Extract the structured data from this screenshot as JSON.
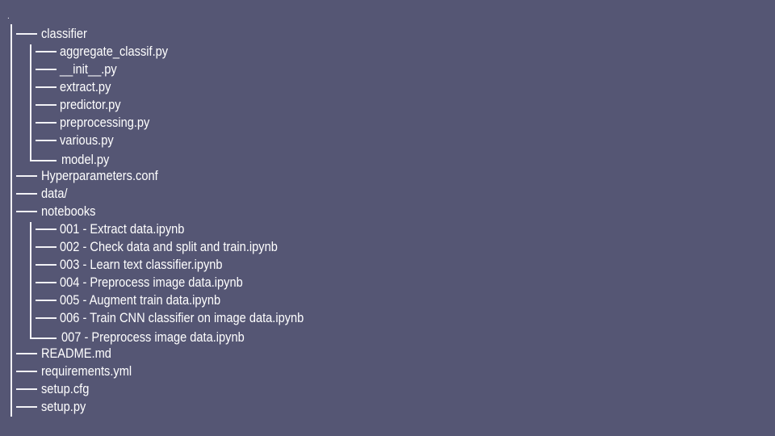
{
  "root": ".",
  "tree": [
    {
      "name": "classifier",
      "children": [
        "aggregate_classif.py",
        "__init__.py",
        "extract.py",
        "predictor.py",
        "preprocessing.py",
        "various.py",
        "model.py"
      ]
    },
    {
      "name": "Hyperparameters.conf"
    },
    {
      "name": "data/"
    },
    {
      "name": "notebooks",
      "children": [
        "001 - Extract data.ipynb",
        "002 - Check data and split and train.ipynb",
        "003 - Learn text classifier.ipynb",
        "004 - Preprocess image data.ipynb",
        "005 - Augment train data.ipynb",
        "006 - Train CNN classifier on image data.ipynb",
        "007 - Preprocess image data.ipynb"
      ]
    },
    {
      "name": "README.md"
    },
    {
      "name": "requirements.yml"
    },
    {
      "name": "setup.cfg"
    },
    {
      "name": "setup.py"
    }
  ],
  "colors": {
    "background": "#555674",
    "text": "#ffffff",
    "lines": "#f2f2f6"
  }
}
